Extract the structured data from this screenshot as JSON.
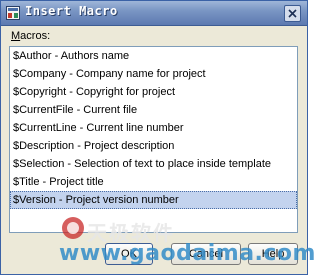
{
  "window": {
    "title": "Insert Macro",
    "icon": "application-icon",
    "close_icon": "close-icon"
  },
  "macros_label_prefix": "M",
  "macros_label_rest": "acros:",
  "macros": [
    {
      "label": "$Author - Authors name",
      "selected": false
    },
    {
      "label": "$Company - Company name for project",
      "selected": false
    },
    {
      "label": "$Copyright - Copyright for project",
      "selected": false
    },
    {
      "label": "$CurrentFile - Current file",
      "selected": false
    },
    {
      "label": "$CurrentLine - Current line number",
      "selected": false
    },
    {
      "label": "$Description - Project description",
      "selected": false
    },
    {
      "label": "$Selection - Selection of text to place inside template",
      "selected": false
    },
    {
      "label": "$Title - Project title",
      "selected": false
    },
    {
      "label": "$Version - Project version number",
      "selected": true
    }
  ],
  "buttons": {
    "ok": "OK",
    "cancel": "Cancel",
    "help": "Help"
  },
  "watermark": {
    "site_name_cn": "天极软件",
    "url": "www.gaodaima.com"
  },
  "colors": {
    "titlebar": "#7a96c4",
    "selection": "#c3d3ee",
    "dialog_bg": "#ece9d8",
    "watermark_url": "#328cc8"
  }
}
